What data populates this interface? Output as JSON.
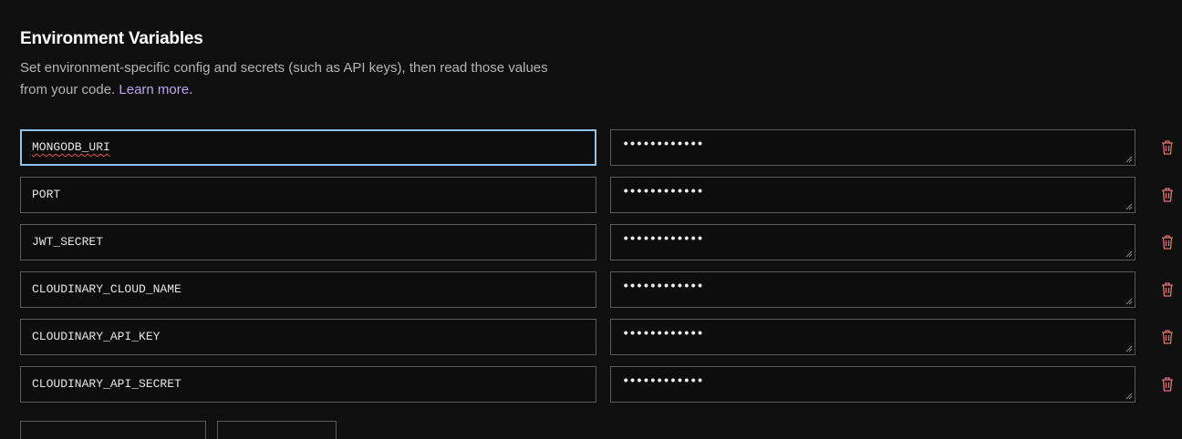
{
  "section": {
    "title": "Environment Variables",
    "description": "Set environment-specific config and secrets (such as API keys), then read those values from your code.",
    "learn_more": "Learn more."
  },
  "env_vars": [
    {
      "key": "MONGODB_URI",
      "value": "••••••••••••"
    },
    {
      "key": "PORT",
      "value": "••••••••••••"
    },
    {
      "key": "JWT_SECRET",
      "value": "••••••••••••"
    },
    {
      "key": "CLOUDINARY_CLOUD_NAME",
      "value": "••••••••••••"
    },
    {
      "key": "CLOUDINARY_API_KEY",
      "value": "••••••••••••"
    },
    {
      "key": "CLOUDINARY_API_SECRET",
      "value": "••••••••••••"
    }
  ],
  "icons": {
    "delete": "trash-icon",
    "resize": "resize-grip-icon"
  },
  "colors": {
    "background": "#0f0f0f",
    "link": "#b9a6f3",
    "focus_border": "#8ec4ee",
    "trash": "#e07474"
  }
}
